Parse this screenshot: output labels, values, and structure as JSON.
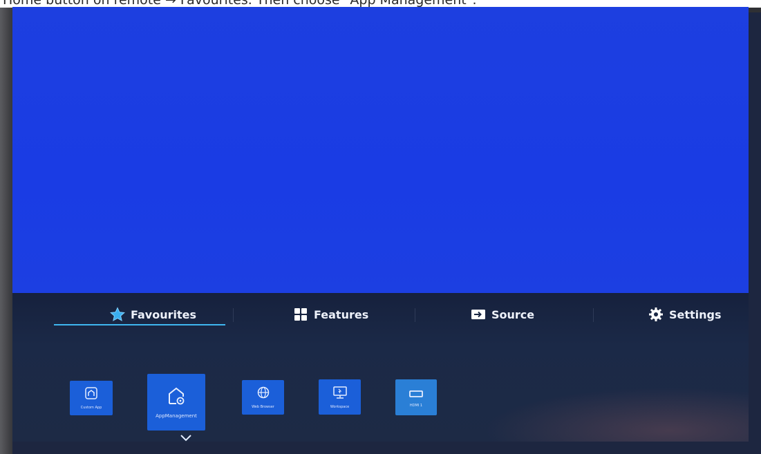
{
  "caption": {
    "text": "Home button on remote → Favourites. Then choose \"App Management\"."
  },
  "tv": {
    "screen_color": "#1b3de2",
    "menu_bg": "#1a2744",
    "accent": "#3fb7f0"
  },
  "tabs": [
    {
      "label": "Favourites",
      "icon": "star-icon",
      "selected": true
    },
    {
      "label": "Features",
      "icon": "grid-icon",
      "selected": false
    },
    {
      "label": "Source",
      "icon": "input-source-icon",
      "selected": false
    },
    {
      "label": "Settings",
      "icon": "gear-icon",
      "selected": false
    }
  ],
  "apps": [
    {
      "label": "Custom App",
      "icon": "home-app-icon"
    },
    {
      "label": "AppManagement",
      "icon": "home-gear-icon",
      "focused": true
    },
    {
      "label": "Web Browser",
      "icon": "globe-icon"
    },
    {
      "label": "Workspace",
      "icon": "monitor-icon"
    },
    {
      "label": "HDMI 1",
      "icon": "hdmi-icon"
    }
  ]
}
